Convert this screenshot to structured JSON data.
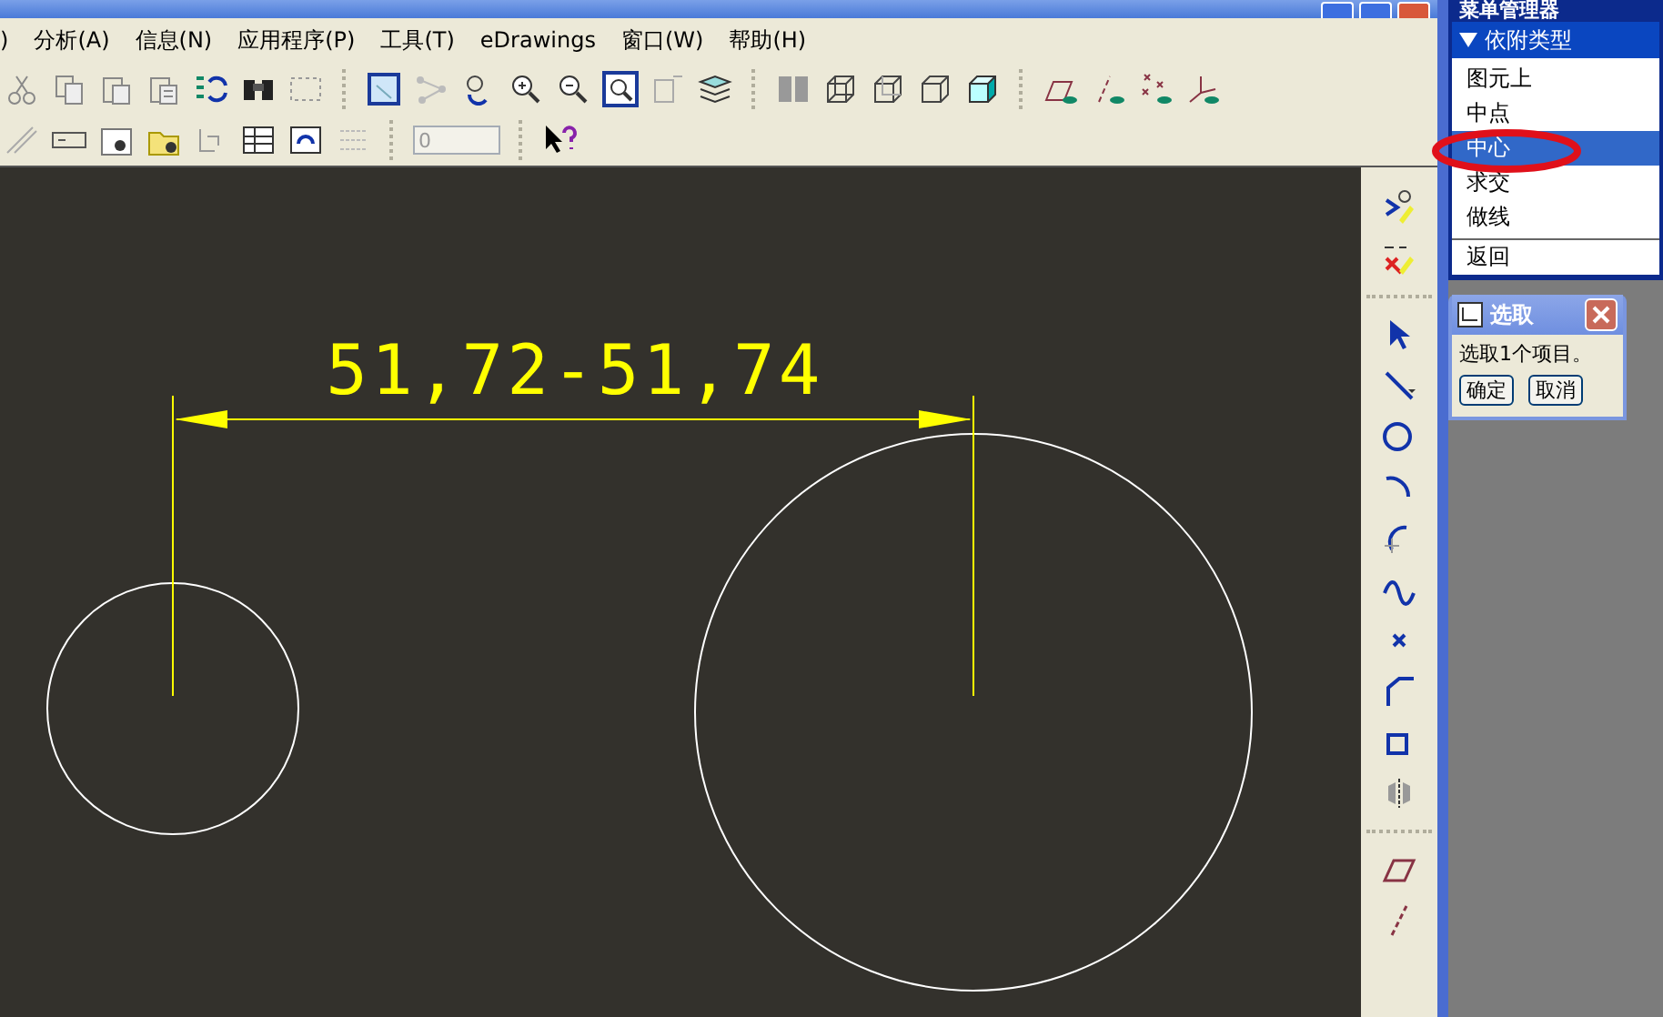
{
  "menu_bar": [
    ")",
    "分析(A)",
    "信息(N)",
    "应用程序(P)",
    "工具(T)",
    "eDrawings",
    "窗口(W)",
    "帮助(H)"
  ],
  "toolbar": {
    "spin_field": {
      "value": "0"
    }
  },
  "drawing": {
    "dimension_text": "51,72-51,74"
  },
  "menu_manager": {
    "title": "菜单管理器",
    "section": "依附类型",
    "items": [
      {
        "label": "图元上",
        "selected": false
      },
      {
        "label": "中点",
        "selected": false
      },
      {
        "label": "中心",
        "selected": true
      },
      {
        "label": "求交",
        "selected": false
      },
      {
        "label": "做线",
        "selected": false
      }
    ],
    "back": "返回"
  },
  "select_dialog": {
    "title": "选取",
    "message": "选取1个项目。",
    "buttons": [
      "确定",
      "取消"
    ]
  }
}
